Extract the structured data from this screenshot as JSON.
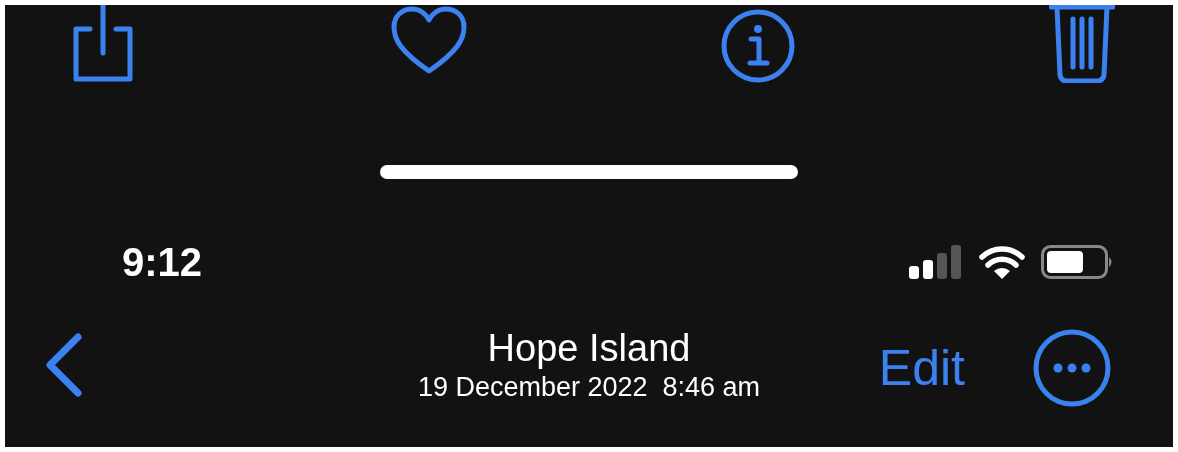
{
  "toolbar": [
    {
      "kind": "share"
    },
    {
      "kind": "heart"
    },
    {
      "kind": "info"
    },
    {
      "kind": "trash"
    }
  ],
  "status_bar": {
    "time": "9:12"
  },
  "nav_bar": {
    "title": "Hope Island",
    "subtitle": "19 December 2022  8:46 am",
    "edit_label": "Edit"
  }
}
